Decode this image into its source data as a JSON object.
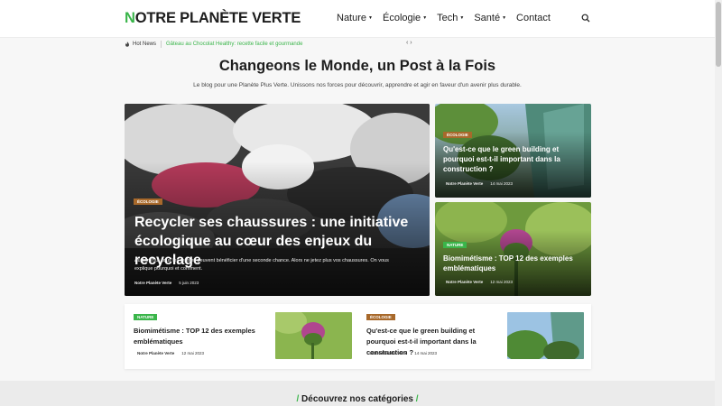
{
  "header": {
    "logo_first": "N",
    "logo_rest": "OTRE PLANÈTE VERTE",
    "nav": [
      {
        "label": "Nature",
        "has_dropdown": true
      },
      {
        "label": "Écologie",
        "has_dropdown": true
      },
      {
        "label": "Tech",
        "has_dropdown": true
      },
      {
        "label": "Santé",
        "has_dropdown": true
      },
      {
        "label": "Contact",
        "has_dropdown": false
      }
    ],
    "caret": "▼",
    "search_icon": "search-icon"
  },
  "hot_news": {
    "label": "Hot News",
    "headline": "Gâteau au Chocolat Healthy: recette facile et gourmande",
    "arrows": "‹ ›"
  },
  "hero": {
    "title": "Changeons le Monde, un Post à la Fois",
    "subtitle": "Le blog pour une Planète Plus Verte. Unissons nos forces pour découvrir, apprendre et agir en faveur d'un avenir plus durable."
  },
  "featured": {
    "badge": "ÉCOLOGIE",
    "title": "Recycler ses chaussures : une initiative écologique au cœur des enjeux du recyclage",
    "excerpt": "Aujourd'hui, tous les textiles peuvent bénéficier d'une seconde chance. Alors ne jetez plus vos chaussures. On vous explique pourquoi et comment.",
    "author": "Notre Planète Verte",
    "date": "5 juin 2023"
  },
  "side_cards": [
    {
      "badge": "ÉCOLOGIE",
      "title": "Qu'est-ce que le green building et pourquoi est-t-il important dans la construction ?",
      "author": "Notre Planète Verte",
      "date": "14 mai 2023"
    },
    {
      "badge": "NATURE",
      "title": "Biomimétisme : TOP 12 des exemples emblématiques",
      "author": "Notre Planète Verte",
      "date": "12 mai 2023"
    }
  ],
  "bottom_cards": [
    {
      "badge": "NATURE",
      "title": "Biomimétisme : TOP 12 des exemples emblématiques",
      "author": "Notre Planète Verte",
      "date": "12 mai 2023"
    },
    {
      "badge": "ÉCOLOGIE",
      "title": "Qu'est-ce que le green building et pourquoi est-t-il important dans la construction ?",
      "author": "Notre Planète Verte",
      "date": "14 mai 2023"
    }
  ],
  "categories": {
    "slash": "/",
    "heading": "Découvrez nos catégories"
  },
  "colors": {
    "brand_green": "#3ab54a",
    "ecology_badge": "#a8692b"
  }
}
